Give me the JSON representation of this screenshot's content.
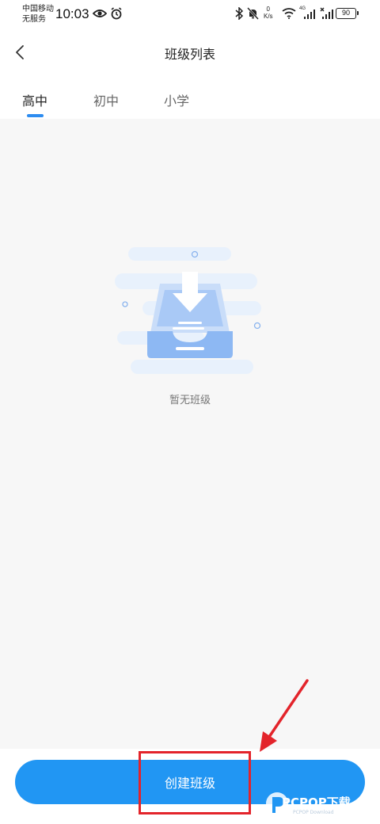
{
  "status_bar": {
    "carrier_line1": "中国移动",
    "carrier_line2": "无服务",
    "time": "10:03",
    "net_speed_value": "0",
    "net_speed_unit": "K/s",
    "network_type": "4G",
    "battery": "90"
  },
  "header": {
    "title": "班级列表"
  },
  "tabs": [
    {
      "label": "高中",
      "active": true
    },
    {
      "label": "初中",
      "active": false
    },
    {
      "label": "小学",
      "active": false
    }
  ],
  "empty_state": {
    "text": "暂无班级"
  },
  "actions": {
    "create_label": "创建班级"
  },
  "watermark": {
    "text": "PCPOP下载",
    "sub": "PCPOP Download"
  },
  "colors": {
    "accent": "#2196f3",
    "tab_indicator": "#2d8cf0",
    "highlight": "#e3242b",
    "background": "#f7f7f7"
  }
}
